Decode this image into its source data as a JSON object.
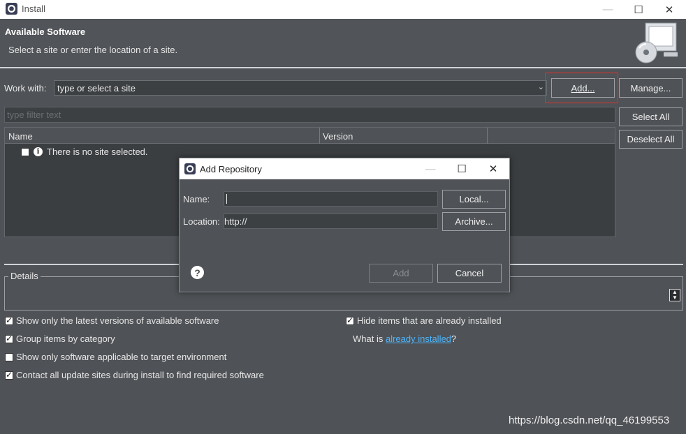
{
  "window": {
    "title": "Install",
    "minimize_icon": "—",
    "maximize_icon": "☐",
    "close_icon": "✕"
  },
  "header": {
    "title": "Available Software",
    "description": "Select a site or enter the location of a site."
  },
  "work_with": {
    "label": "Work with:",
    "value": "type or select a site",
    "add_button": "Add...",
    "manage_button": "Manage..."
  },
  "filter": {
    "placeholder": "type filter text"
  },
  "side_buttons": {
    "select_all": "Select All",
    "deselect_all": "Deselect All"
  },
  "table": {
    "columns": [
      "Name",
      "Version"
    ],
    "rows": [
      {
        "name": "There is no site selected.",
        "version": ""
      }
    ]
  },
  "details": {
    "label": "Details"
  },
  "options": {
    "latest_versions": "Show only the latest versions of available software",
    "group_by_category": "Group items by category",
    "target_environment": "Show only software applicable to target environment",
    "contact_sites": "Contact all update sites during install to find required software",
    "hide_installed": "Hide items that are already installed",
    "what_is_prefix": "What is ",
    "already_installed_link": "already installed",
    "what_is_suffix": "?"
  },
  "dialog": {
    "title": "Add Repository",
    "name_label": "Name:",
    "name_value": "",
    "location_label": "Location:",
    "location_value": "http://",
    "local_button": "Local...",
    "archive_button": "Archive...",
    "add_button": "Add",
    "cancel_button": "Cancel",
    "help_icon": "?"
  },
  "watermark": "https://blog.csdn.net/qq_46199553"
}
